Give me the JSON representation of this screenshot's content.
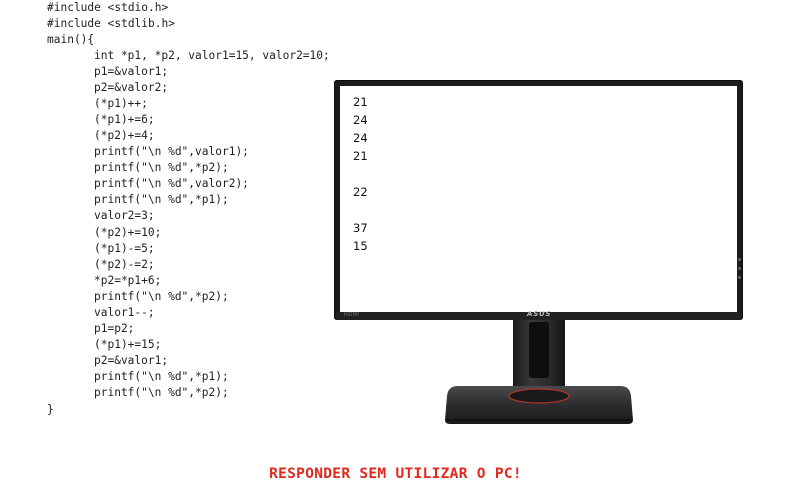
{
  "code": [
    "#include <stdio.h>",
    "#include <stdlib.h>",
    "main(){",
    "int *p1, *p2, valor1=15, valor2=10;",
    "p1=&valor1;",
    "p2=&valor2;",
    "(*p1)++;",
    "(*p1)+=6;",
    "(*p2)+=4;",
    "printf(\"\\n %d\",valor1);",
    "printf(\"\\n %d\",*p2);",
    "printf(\"\\n %d\",valor2);",
    "printf(\"\\n %d\",*p1);",
    "valor2=3;",
    "(*p2)+=10;",
    "(*p1)-=5;",
    "(*p2)-=2;",
    "*p2=*p1+6;",
    "printf(\"\\n %d\",*p2);",
    "valor1--;",
    "p1=p2;",
    "(*p1)+=15;",
    "p2=&valor1;",
    "printf(\"\\n %d\",*p1);",
    "printf(\"\\n %d\",*p2);",
    "}"
  ],
  "screen_output": [
    "21",
    "24",
    "24",
    "21",
    "22",
    "37",
    "15"
  ],
  "monitor": {
    "brand": "ASUS",
    "port_label": "HDMI"
  },
  "warning": "RESPONDER SEM UTILIZAR O PC!",
  "colors": {
    "warning": "#e0281e",
    "code": "#222222",
    "bezel": "#1b1b1b",
    "base_accent": "#b5342c"
  }
}
